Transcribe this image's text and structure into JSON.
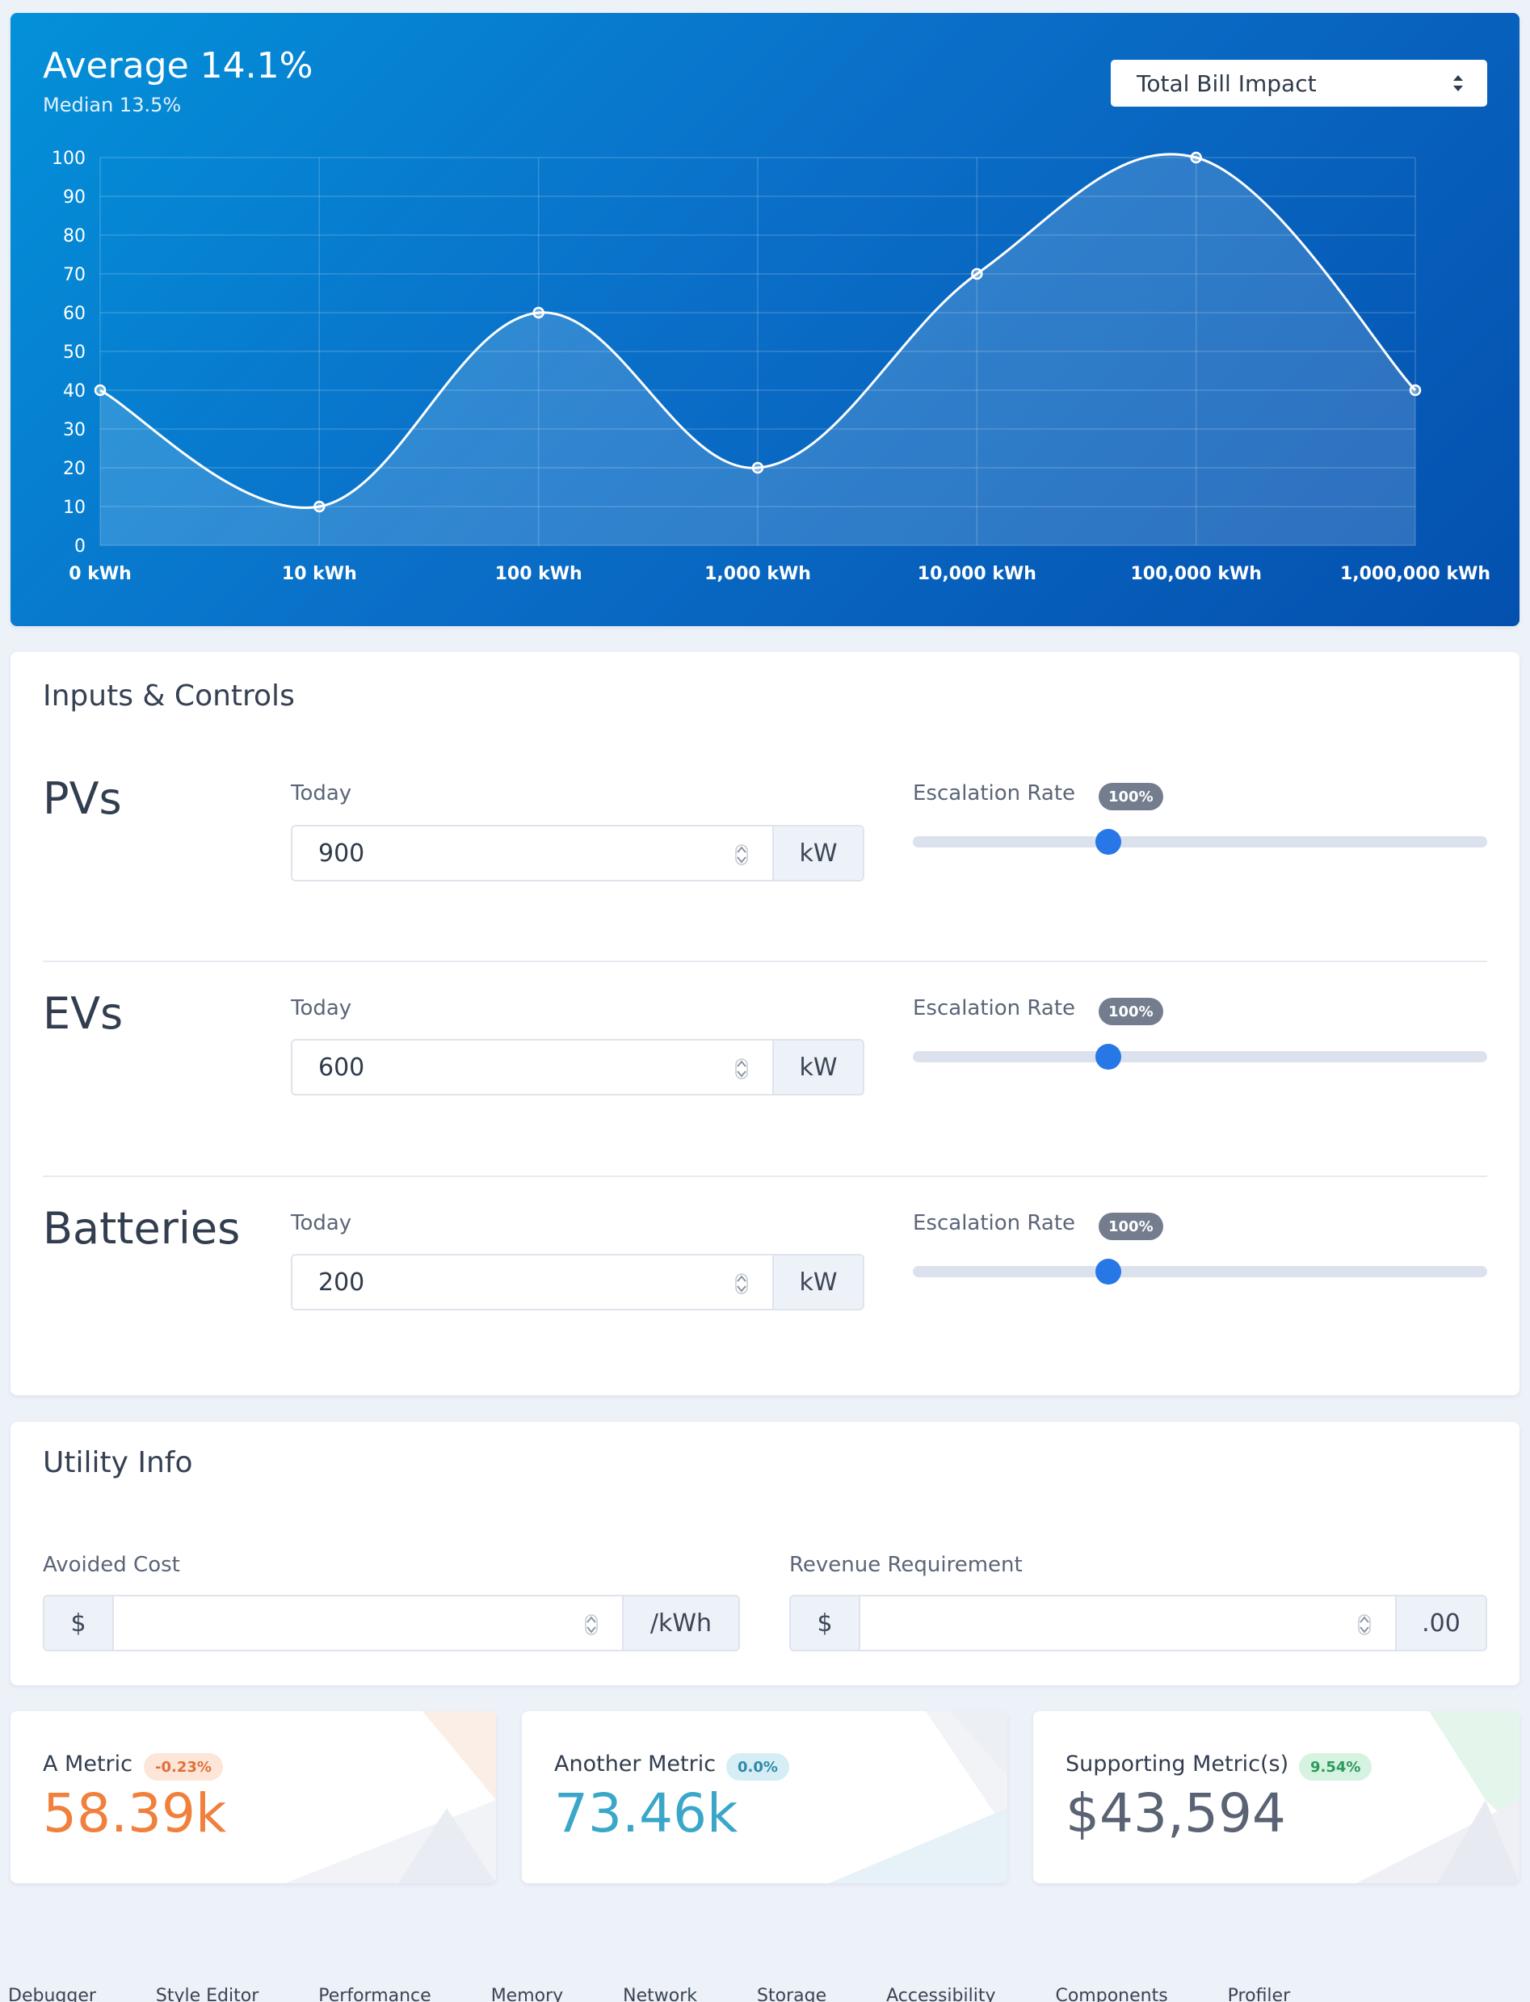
{
  "header": {
    "average_label": "Average 14.1%",
    "median_label": "Median 13.5%",
    "select_value": "Total Bill Impact"
  },
  "chart_data": {
    "type": "area",
    "categories": [
      "0 kWh",
      "10 kWh",
      "100 kWh",
      "1,000 kWh",
      "10,000 kWh",
      "100,000 kWh",
      "1,000,000 kWh"
    ],
    "series": [
      {
        "values": [
          40,
          10,
          60,
          20,
          70,
          100,
          40
        ]
      }
    ],
    "yticks": [
      "0",
      "10",
      "20",
      "30",
      "40",
      "50",
      "60",
      "70",
      "80",
      "90",
      "100"
    ],
    "ylim": [
      0,
      100
    ],
    "xlabel": "",
    "ylabel": "",
    "grid": true,
    "colors": {
      "line": "#ffffff",
      "fill": "rgba(255,255,255,0.16)"
    }
  },
  "inputs": {
    "title": "Inputs & Controls",
    "rows": [
      {
        "label": "PVs",
        "today_label": "Today",
        "value": "900",
        "unit": "kW",
        "rate_label": "Escalation Rate",
        "rate_badge": "100%",
        "slider_level": 0.34
      },
      {
        "label": "EVs",
        "today_label": "Today",
        "value": "600",
        "unit": "kW",
        "rate_label": "Escalation Rate",
        "rate_badge": "100%",
        "slider_level": 0.34
      },
      {
        "label": "Batteries",
        "today_label": "Today",
        "value": "200",
        "unit": "kW",
        "rate_label": "Escalation Rate",
        "rate_badge": "100%",
        "slider_level": 0.34
      }
    ]
  },
  "utility": {
    "title": "Utility Info",
    "avoided_cost": {
      "label": "Avoided Cost",
      "prefix": "$",
      "value": "",
      "suffix": "/kWh"
    },
    "revenue": {
      "label": "Revenue Requirement",
      "prefix": "$",
      "value": "",
      "suffix": ".00"
    }
  },
  "metrics": [
    {
      "label": "A Metric",
      "badge": "-0.23%",
      "value": "58.39k",
      "value_color": "#f0803c",
      "badge_bg": "#fde5d8",
      "badge_color": "#e0703a"
    },
    {
      "label": "Another Metric",
      "badge": "0.0%",
      "value": "73.46k",
      "value_color": "#3aa7c9",
      "badge_bg": "#d5eef5",
      "badge_color": "#2f8aa8"
    },
    {
      "label": "Supporting Metric(s)",
      "badge": "9.54%",
      "value": "$43,594",
      "value_color": "#5a6373",
      "badge_bg": "#d6f3e2",
      "badge_color": "#2c9a5a"
    }
  ],
  "devtools": [
    "Debugger",
    "Style Editor",
    "Performance",
    "Memory",
    "Network",
    "Storage",
    "Accessibility",
    "Components",
    "Profiler"
  ]
}
